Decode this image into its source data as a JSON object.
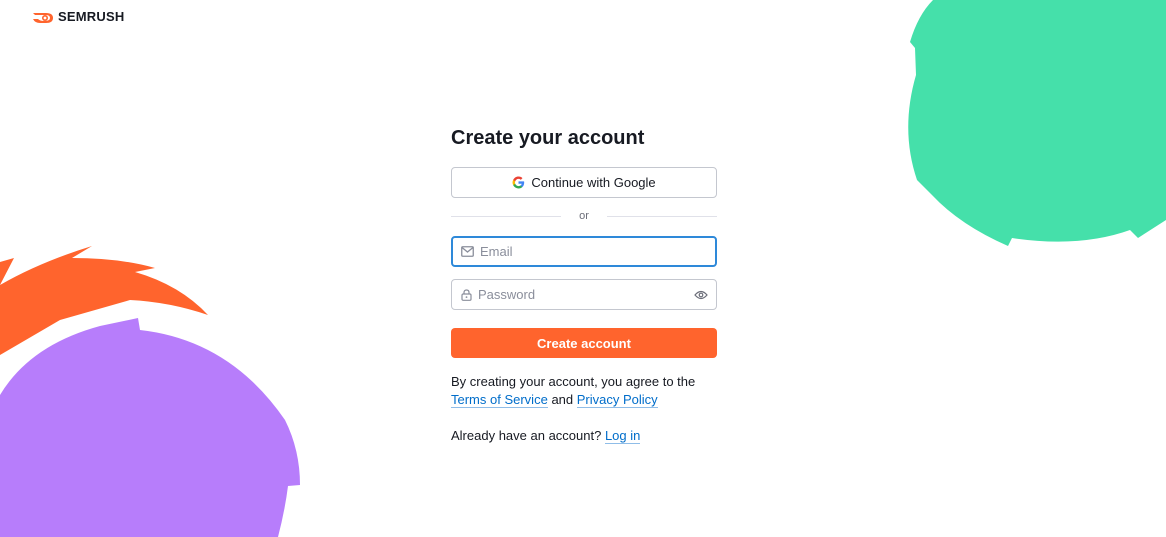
{
  "brand": {
    "name": "SEMRUSH",
    "icon": "semrush-flame-logo-icon",
    "accent_color": "#ff642d"
  },
  "form": {
    "title": "Create your account",
    "google_button_label": "Continue with Google",
    "divider_text": "or",
    "email": {
      "placeholder": "Email",
      "value": "",
      "icon": "mail-icon"
    },
    "password": {
      "placeholder": "Password",
      "value": "",
      "icon": "lock-icon",
      "toggle_icon": "eye-icon"
    },
    "submit_label": "Create account",
    "terms_prefix": "By creating your account, you agree to the",
    "terms_link": "Terms of Service",
    "terms_and": "and",
    "privacy_link": "Privacy Policy",
    "login_prefix": "Already have an account?",
    "login_link": "Log in"
  },
  "colors": {
    "primary_button": "#ff642d",
    "link": "#006dca",
    "focus_border": "#2e89d9",
    "decor_green": "#45e0aa",
    "decor_purple": "#b77dfb",
    "decor_orange": "#ff642d"
  }
}
